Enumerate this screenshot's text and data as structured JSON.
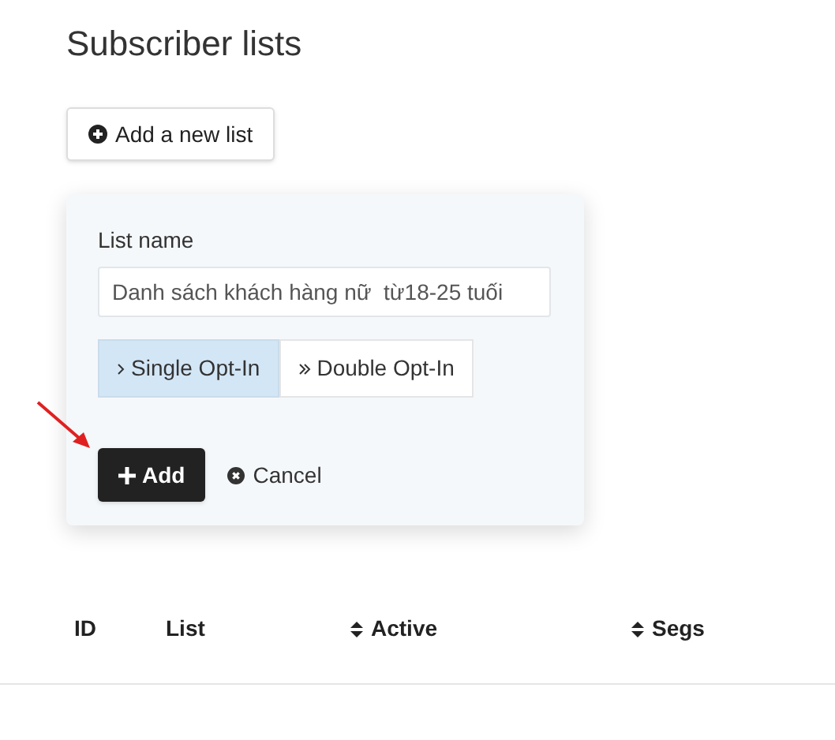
{
  "title": "Subscriber lists",
  "add_list_button": {
    "label": "Add a new list"
  },
  "form": {
    "label": "List name",
    "value": "Danh sách khách hàng nữ  từ18-25 tuối",
    "opt_in": [
      {
        "kind": "single",
        "label": "Single Opt-In",
        "selected": true
      },
      {
        "kind": "double",
        "label": "Double Opt-In",
        "selected": false
      }
    ],
    "submit": {
      "label": "Add"
    },
    "cancel": {
      "label": "Cancel"
    }
  },
  "table": {
    "columns": [
      {
        "label": "ID",
        "sortable": false
      },
      {
        "label": "List",
        "sortable": false
      },
      {
        "label": "Active",
        "sortable": true
      },
      {
        "label": "Segs",
        "sortable": true
      }
    ]
  }
}
